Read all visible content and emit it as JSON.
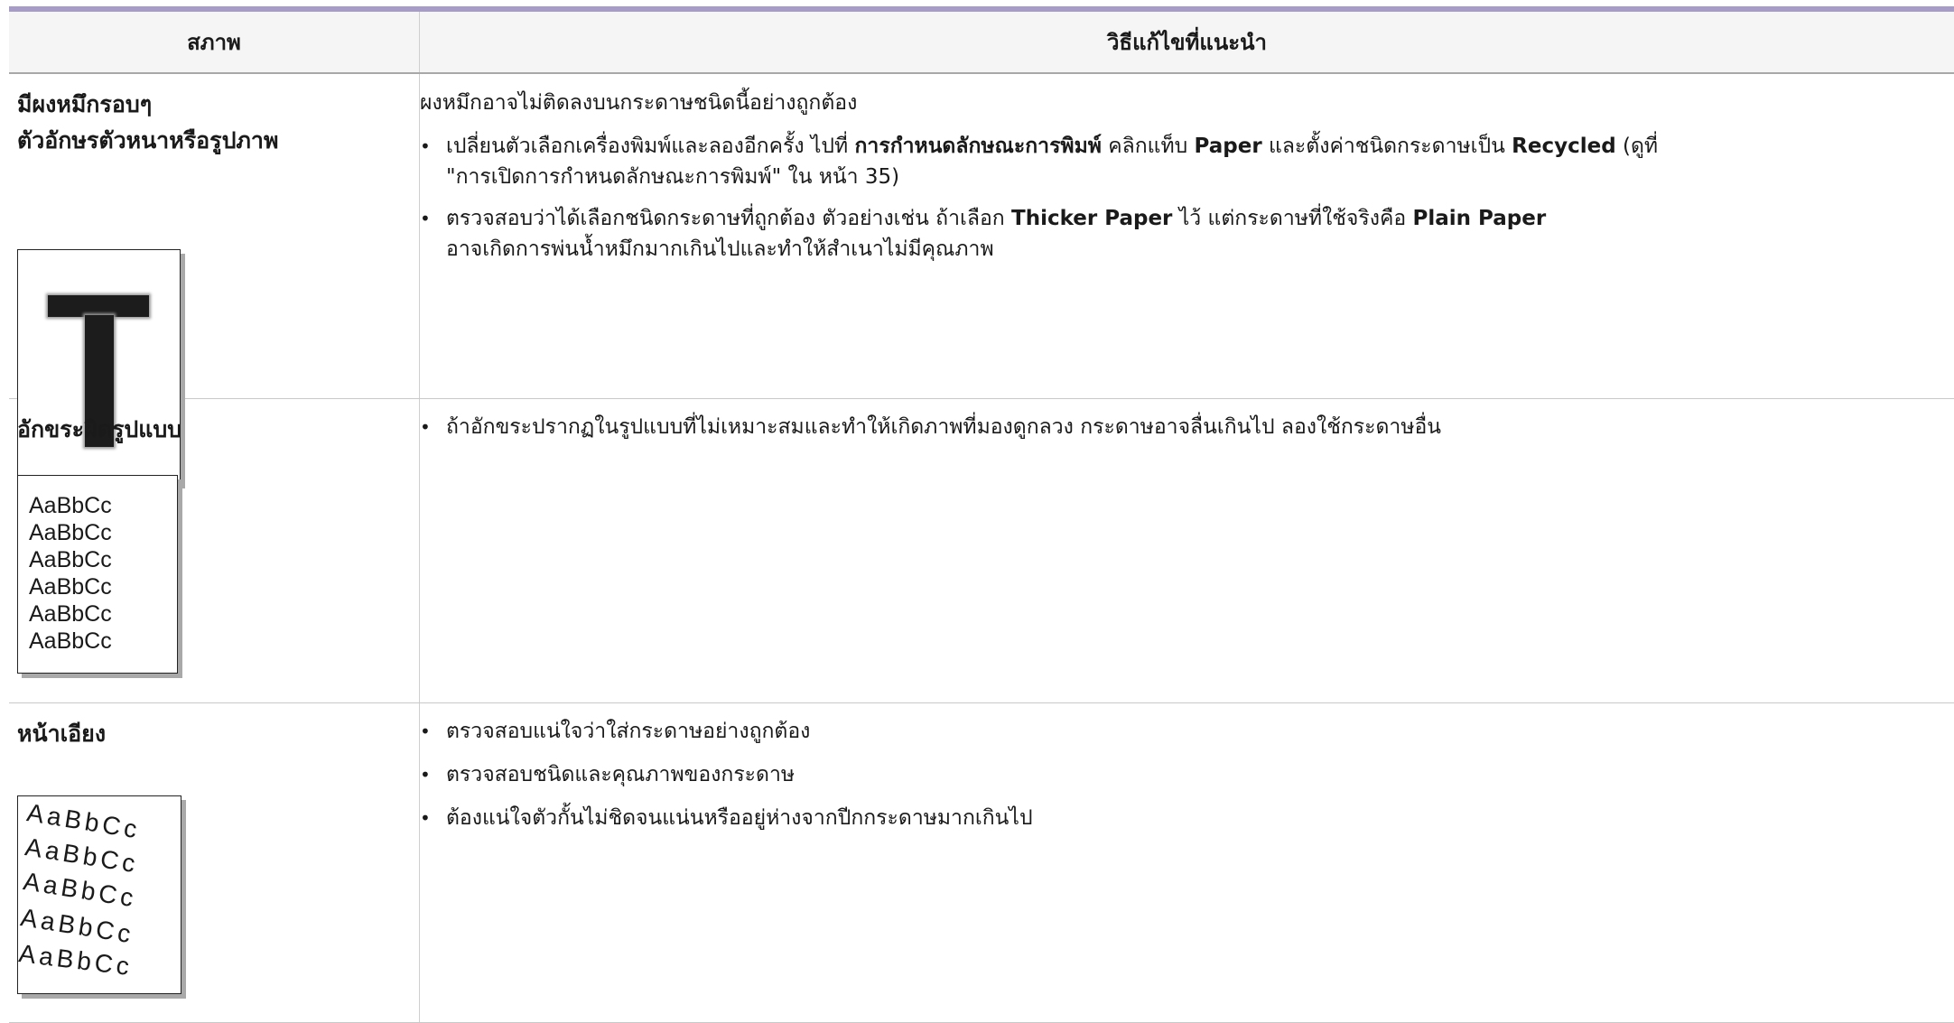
{
  "header": {
    "condition": "สภาพ",
    "solution": "วิธีแก้ไขที่แนะนำ"
  },
  "rows": [
    {
      "title_line1": "มีผงหมึกรอบๆ",
      "title_line2": "ตัวอักษรตัวหนาหรือรูปภาพ",
      "sample_glyph": "T",
      "lead": "ผงหมึกอาจไม่ติดลงบนกระดาษชนิดนี้อย่างถูกต้อง",
      "b1_t1": "เปลี่ยนตัวเลือกเครื่องพิมพ์และลองอีกครั้ง ไปที่ ",
      "b1_bold1": "การกำหนดลักษณะการพิมพ์",
      "b1_t2": " คลิกแท็บ ",
      "b1_bold2": "Paper",
      "b1_t3": " และตั้งค่าชนิดกระดาษเป็น ",
      "b1_bold3": "Recycled",
      "b1_t4": " (ดูที่",
      "b1_t5": "\"การเปิดการกำหนดลักษณะการพิมพ์\"  ใน หน้า 35)",
      "b2_t1": "ตรวจสอบว่าได้เลือกชนิดกระดาษที่ถูกต้อง ตัวอย่างเช่น ถ้าเลือก ",
      "b2_bold1": "Thicker Paper",
      "b2_t2": " ไว้ แต่กระดาษที่ใช้จริงคือ ",
      "b2_bold2": "Plain Paper",
      "b2_t3": "อาจเกิดการพ่นน้ำหมึกมากเกินไปและทำให้สำเนาไม่มีคุณภาพ"
    },
    {
      "title": "อักขระผิดรูปแบบ",
      "sample_lines": [
        "AaBbCc",
        "AaBbCc",
        "AaBbCc",
        "AaBbCc",
        "AaBbCc",
        "AaBbCc"
      ],
      "b1": "ถ้าอักขระปรากฏในรูปแบบที่ไม่เหมาะสมและทำให้เกิดภาพที่มองดูกลวง กระดาษอาจลื่นเกินไป ลองใช้กระดาษอื่น"
    },
    {
      "title": "หน้าเอียง",
      "sample_lines": [
        "AaBbCc",
        "AaBbCc",
        "AaBbCc",
        "AaBbCc",
        "AaBbCc"
      ],
      "b1": "ตรวจสอบแน่ใจว่าใส่กระดาษอย่างถูกต้อง",
      "b2": "ตรวจสอบชนิดและคุณภาพของกระดาษ",
      "b3": "ต้องแน่ใจตัวกั้นไม่ชิดจนแน่นหรืออยู่ห่างจากปีกกระดาษมากเกินไป"
    }
  ]
}
